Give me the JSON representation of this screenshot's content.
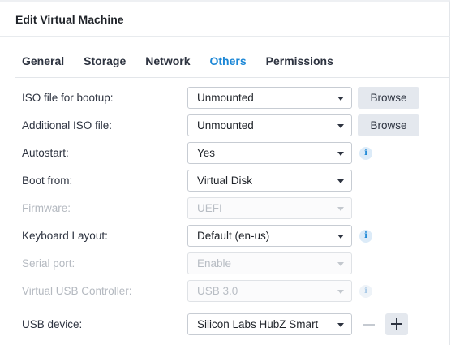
{
  "dialog": {
    "title": "Edit Virtual Machine"
  },
  "tabs": [
    {
      "label": "General",
      "active": false
    },
    {
      "label": "Storage",
      "active": false
    },
    {
      "label": "Network",
      "active": false
    },
    {
      "label": "Others",
      "active": true
    },
    {
      "label": "Permissions",
      "active": false
    }
  ],
  "colors": {
    "accent": "#1c87d6",
    "button_bg": "#e4e8ee",
    "disabled_text": "#b4b9c0"
  },
  "fields": {
    "iso_boot": {
      "label": "ISO file for bootup:",
      "value": "Unmounted",
      "button": "Browse",
      "disabled": false
    },
    "iso_additional": {
      "label": "Additional ISO file:",
      "value": "Unmounted",
      "button": "Browse",
      "disabled": false
    },
    "autostart": {
      "label": "Autostart:",
      "value": "Yes",
      "info_icon": "info-icon",
      "disabled": false
    },
    "boot_from": {
      "label": "Boot from:",
      "value": "Virtual Disk",
      "disabled": false
    },
    "firmware": {
      "label": "Firmware:",
      "value": "UEFI",
      "disabled": true
    },
    "keyboard": {
      "label": "Keyboard Layout:",
      "value": "Default (en-us)",
      "info_icon": "info-icon",
      "disabled": false
    },
    "serial_port": {
      "label": "Serial port:",
      "value": "Enable",
      "disabled": true
    },
    "usb_controller": {
      "label": "Virtual USB Controller:",
      "value": "USB 3.0",
      "info_icon": "info-icon",
      "disabled": true
    },
    "usb_device": {
      "label": "USB device:",
      "value": "Silicon Labs HubZ Smart",
      "remove_icon": "minus-icon",
      "add_icon": "plus-icon",
      "disabled": false
    }
  },
  "icons": {
    "info_glyph": "i"
  }
}
